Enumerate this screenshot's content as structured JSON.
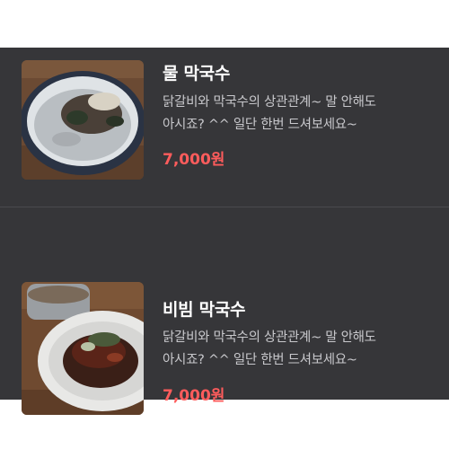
{
  "menu": {
    "items": [
      {
        "name": "물 막국수",
        "description_line1": "닭갈비와 막국수의 상관관계~ 말 안해도",
        "description_line2": "아시죠? ^^ 일단 한번 드셔보세요~",
        "price": "7,000원"
      },
      {
        "name": "비빔 막국수",
        "description_line1": "닭갈비와 막국수의 상관관계~ 말 안해도",
        "description_line2": "아시죠? ^^ 일단 한번 드셔보세요~",
        "price": "7,000원"
      }
    ]
  },
  "colors": {
    "panel_bg": "#363639",
    "title": "#ffffff",
    "description": "#c8c8cc",
    "price": "#ff5c5c"
  },
  "icons": [
    "mul-makguksu-photo",
    "bibim-makguksu-photo"
  ]
}
